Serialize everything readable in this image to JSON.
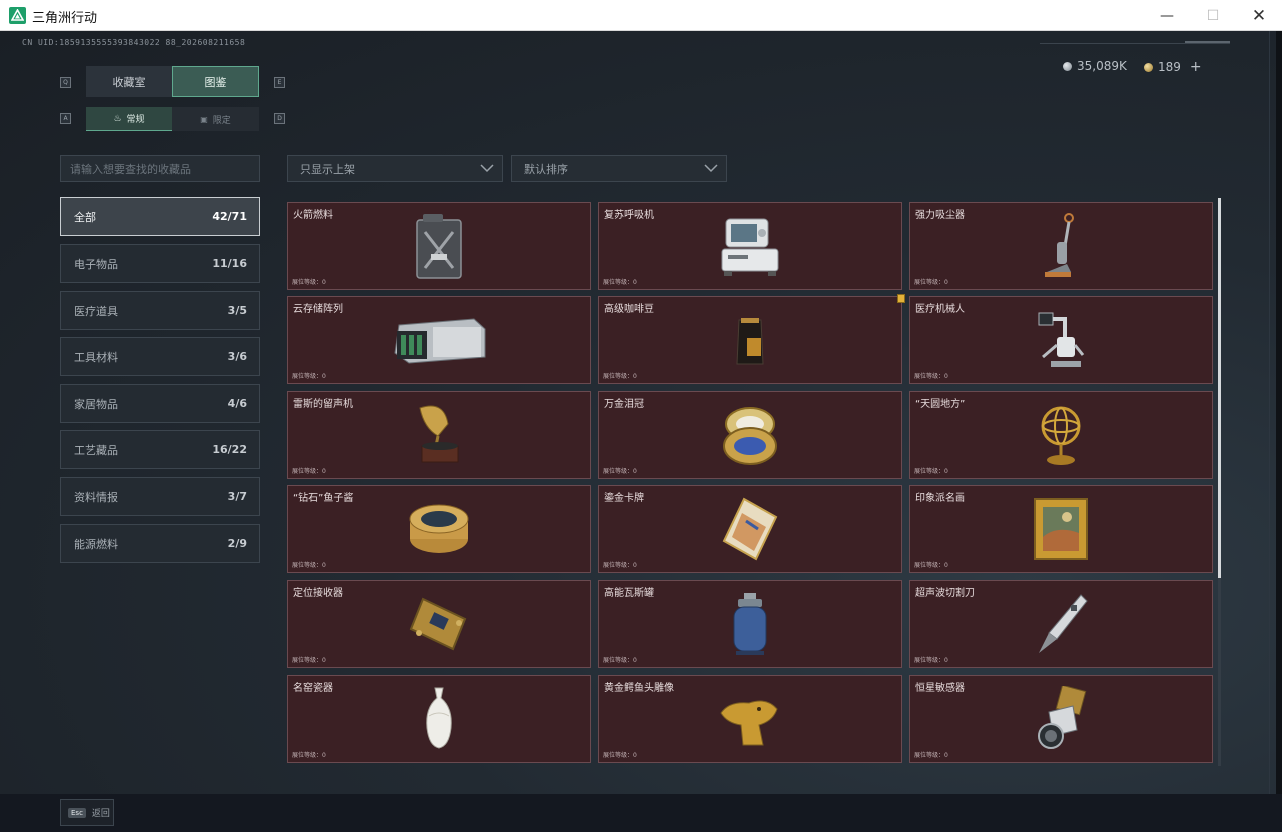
{
  "window": {
    "title": "三角洲行动",
    "minimize": "—",
    "maximize": "☐",
    "close": "✕"
  },
  "header": {
    "uid": "CN UID:1859135555393843022 88_202608211658",
    "currency": [
      {
        "value": "35,089K",
        "icon": "silver-coin-icon",
        "color": "#a9b1b8"
      },
      {
        "value": "189",
        "icon": "gold-coin-icon",
        "color": "#d0b36a"
      }
    ],
    "add": "+"
  },
  "tabs": {
    "key_left": "Q",
    "key_right": "E",
    "items": [
      {
        "label": "收藏室"
      },
      {
        "label": "图鉴"
      }
    ]
  },
  "subtabs": {
    "key_left": "A",
    "key_right": "D",
    "items": [
      {
        "label": "常规"
      },
      {
        "label": "限定"
      }
    ]
  },
  "search": {
    "placeholder": "请输入想要查找的收藏品"
  },
  "filters": {
    "show": "只显示上架",
    "sort": "默认排序"
  },
  "categories": [
    {
      "label": "全部",
      "count": "42/71"
    },
    {
      "label": "电子物品",
      "count": "11/16"
    },
    {
      "label": "医疗道具",
      "count": "3/5"
    },
    {
      "label": "工具材料",
      "count": "3/6"
    },
    {
      "label": "家居物品",
      "count": "4/6"
    },
    {
      "label": "工艺藏品",
      "count": "16/22"
    },
    {
      "label": "资料情报",
      "count": "3/7"
    },
    {
      "label": "能源燃料",
      "count": "2/9"
    }
  ],
  "level_label": "展位等级：0",
  "items": [
    {
      "name": "火箭燃料",
      "icon": "fuel-canister-icon"
    },
    {
      "name": "复苏呼吸机",
      "icon": "ventilator-icon"
    },
    {
      "name": "强力吸尘器",
      "icon": "vacuum-cleaner-icon"
    },
    {
      "name": "云存储阵列",
      "icon": "storage-array-icon"
    },
    {
      "name": "高级咖啡豆",
      "icon": "coffee-bag-icon"
    },
    {
      "name": "医疗机械人",
      "icon": "medical-robot-icon"
    },
    {
      "name": "雷斯的留声机",
      "icon": "gramophone-icon"
    },
    {
      "name": "万金泪冠",
      "icon": "jeweled-egg-icon"
    },
    {
      "name": "“天圆地方”",
      "icon": "armillary-sphere-icon"
    },
    {
      "name": "“钻石”鱼子酱",
      "icon": "caviar-tin-icon"
    },
    {
      "name": "鎏金卡牌",
      "icon": "gilded-card-icon"
    },
    {
      "name": "印象派名画",
      "icon": "framed-painting-icon"
    },
    {
      "name": "定位接收器",
      "icon": "gps-receiver-icon"
    },
    {
      "name": "高能瓦斯罐",
      "icon": "gas-cylinder-icon"
    },
    {
      "name": "超声波切割刀",
      "icon": "ultrasonic-cutter-icon"
    },
    {
      "name": "名窑瓷器",
      "icon": "porcelain-vase-icon"
    },
    {
      "name": "黄金鳄鱼头雕像",
      "icon": "gold-croc-statue-icon"
    },
    {
      "name": "恒星敏感器",
      "icon": "star-sensor-icon"
    }
  ],
  "footer": {
    "key": "Esc",
    "label": "返回"
  }
}
